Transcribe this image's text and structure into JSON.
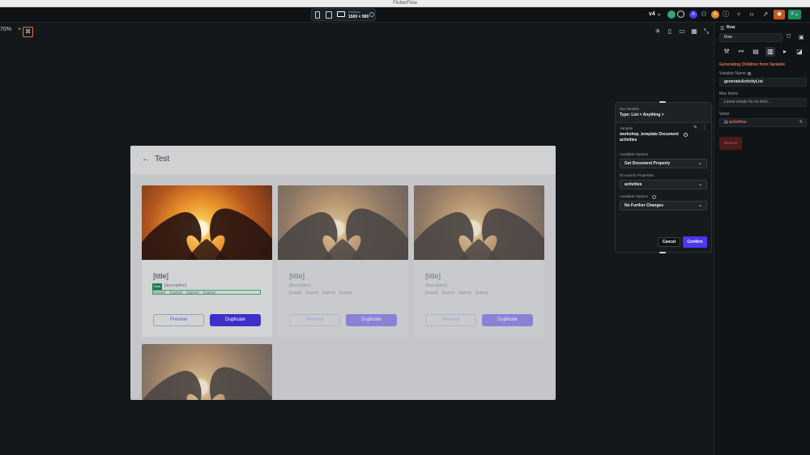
{
  "window": {
    "title": "FlutterFlow"
  },
  "toolbar": {
    "device_label": "Desktop",
    "device_size": "1500 × 900",
    "version": "v4",
    "avatars": [
      "",
      "A",
      "A"
    ]
  },
  "canvas": {
    "zoom": "70%",
    "page_title": "Test",
    "cards": [
      {
        "title": "[title]",
        "description": "[description]",
        "tags": "[name] [name] [name] [name]",
        "preview_label": "Preview",
        "duplicate_label": "Duplicate"
      },
      {
        "title": "[title]",
        "description": "[description]",
        "tags": "[name] [name] [name] [name]",
        "preview_label": "Preview",
        "duplicate_label": "Duplicate"
      },
      {
        "title": "[title]",
        "description": "[description]",
        "tags": "[name] [name] [name] [name]",
        "preview_label": "Preview",
        "duplicate_label": "Duplicate"
      }
    ],
    "row_badge": "Row"
  },
  "right_panel": {
    "widget_type": "Row",
    "widget_name": "Row",
    "section_title": "Generating Children from Variable",
    "variable_name_label": "Variable Name",
    "variable_name_value": "generateActivityList",
    "max_items_label": "Max Items",
    "max_items_placeholder": "Leave empty for no limit...",
    "value_label": "Value",
    "value_value": "activities",
    "remove_label": "Remove"
  },
  "set_variable_popup": {
    "header_label": "Set Variable",
    "type_label": "Type: List < Anything >",
    "variable_label": "Variable",
    "variable_source": "workshop_template Document",
    "variable_field": "activities",
    "available_options_label": "Available Options",
    "available_options_value": "Get Document Property",
    "document_properties_label": "Document Properties",
    "document_properties_value": "activities",
    "available_options2_label": "Available Options",
    "available_options2_value": "No Further Changes",
    "cancel_label": "Cancel",
    "confirm_label": "Confirm"
  },
  "colors": {
    "accent": "#4b39ef",
    "orange": "#e8704a",
    "row_selection": "#3aa66a"
  }
}
